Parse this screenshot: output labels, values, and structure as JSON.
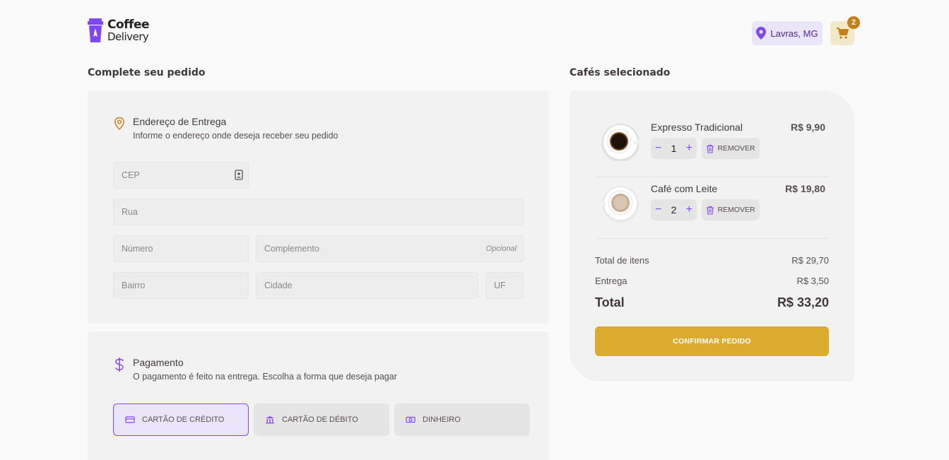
{
  "brand": {
    "line1": "Coffee",
    "line2": "Delivery"
  },
  "header": {
    "location": "Lavras, MG",
    "cart_count": "2"
  },
  "checkout": {
    "title": "Complete seu pedido",
    "address": {
      "title": "Endereço de Entrega",
      "subtitle": "Informe o endereço onde deseja receber seu pedido",
      "fields": {
        "cep": "CEP",
        "rua": "Rua",
        "numero": "Número",
        "complemento": "Complemento",
        "complemento_hint": "Opcional",
        "bairro": "Bairro",
        "cidade": "Cidade",
        "uf": "UF"
      }
    },
    "payment": {
      "title": "Pagamento",
      "subtitle": "O pagamento é feito na entrega. Escolha a forma que deseja pagar",
      "options": [
        "CARTÃO DE CRÉDITO",
        "CARTÃO DE DÉBITO",
        "DINHEIRO"
      ],
      "selected": "CARTÃO DE CRÉDITO"
    }
  },
  "cart": {
    "title": "Cafés selecionado",
    "items": [
      {
        "name": "Expresso Tradicional",
        "price": "R$ 9,90",
        "qty": "1",
        "remove_label": "REMOVER",
        "image": "expresso-cup"
      },
      {
        "name": "Café com Leite",
        "price": "R$ 19,80",
        "qty": "2",
        "remove_label": "REMOVER",
        "image": "latte-cup"
      }
    ],
    "summary": {
      "items_label": "Total de itens",
      "items_value": "R$ 29,70",
      "delivery_label": "Entrega",
      "delivery_value": "R$ 3,50",
      "total_label": "Total",
      "total_value": "R$ 33,20"
    },
    "confirm_label": "CONFIRMAR PEDIDO"
  },
  "colors": {
    "purple": "#8047F8",
    "purple_dark": "#4B2995",
    "yellow": "#DBAC2C",
    "yellow_dark": "#C47F17",
    "base_card": "#F3F2F2"
  }
}
